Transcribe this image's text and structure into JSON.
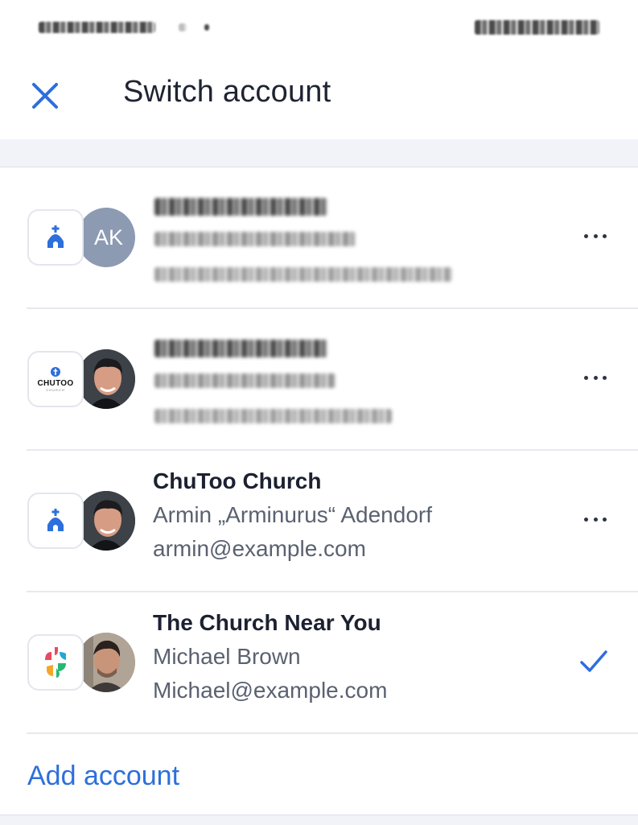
{
  "header": {
    "title": "Switch account"
  },
  "accounts": [
    {
      "org": "ChuToo Church",
      "name": "Armin Adendorf, Gemeinde",
      "email": "admin@example-gemeinde-church.com",
      "avatar_initials": "AK",
      "blurred": true,
      "action": "more-options"
    },
    {
      "org": "ChuToo Church",
      "name": "Armin Adendorf",
      "email": "armin@example-gemeinde.com",
      "logo_text": "CHUTOO",
      "logo_subtext": "CHURCH",
      "blurred": true,
      "action": "more-options"
    },
    {
      "org": "ChuToo Church",
      "name": "Armin „Arminurus“ Adendorf",
      "email": "armin@example.com",
      "action": "more-options"
    },
    {
      "org": "The Church Near You",
      "name": "Michael Brown",
      "email": "Michael@example.com",
      "action": "selected"
    }
  ],
  "footer": {
    "add_account_label": "Add account"
  },
  "colors": {
    "accent": "#2d6fdb",
    "text": "#1c2131",
    "secondary_text": "#5a6170"
  }
}
